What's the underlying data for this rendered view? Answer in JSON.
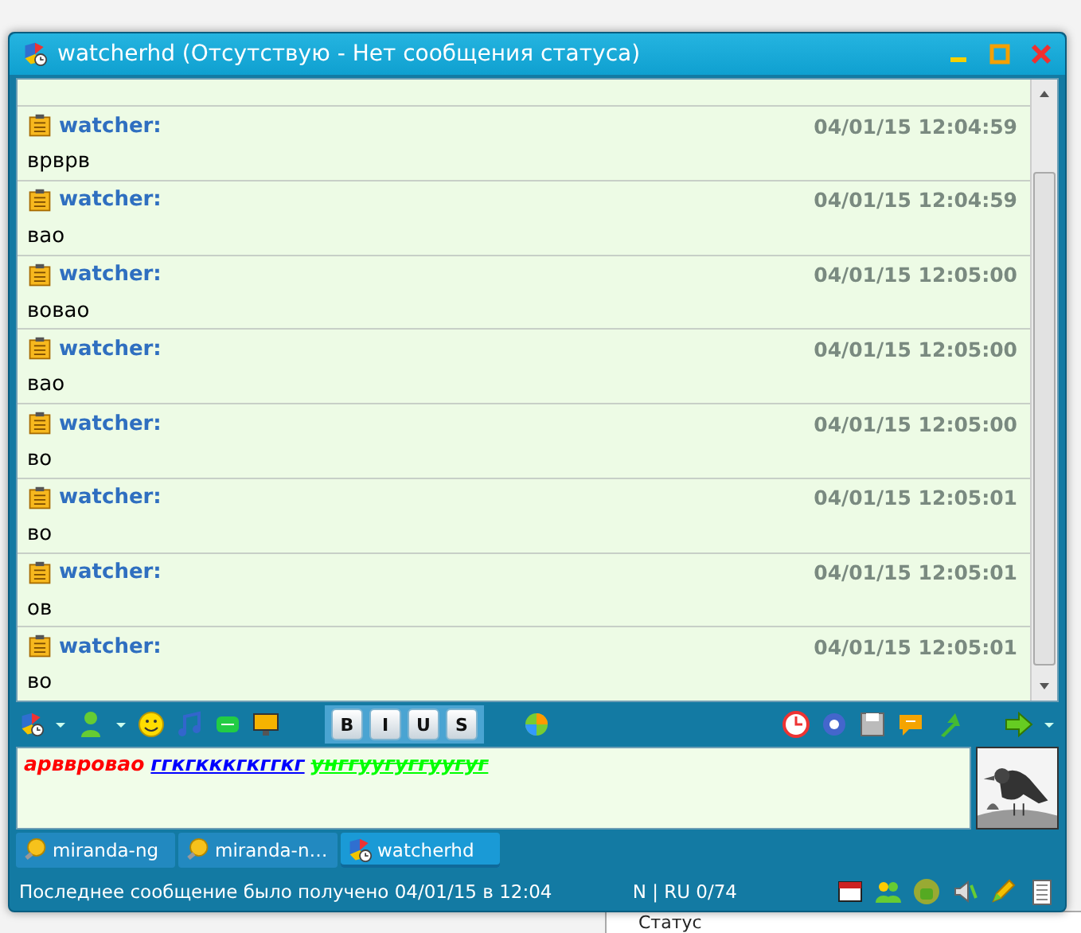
{
  "window": {
    "title": "watcherhd (Отсутствую - Нет сообщения статуса)"
  },
  "messages": [
    {
      "author": "watcher:",
      "time": "04/01/15 12:04:59",
      "text": "врврв"
    },
    {
      "author": "watcher:",
      "time": "04/01/15 12:04:59",
      "text": "вао"
    },
    {
      "author": "watcher:",
      "time": "04/01/15 12:05:00",
      "text": "вовао"
    },
    {
      "author": "watcher:",
      "time": "04/01/15 12:05:00",
      "text": "вао"
    },
    {
      "author": "watcher:",
      "time": "04/01/15 12:05:00",
      "text": "во"
    },
    {
      "author": "watcher:",
      "time": "04/01/15 12:05:01",
      "text": "во"
    },
    {
      "author": "watcher:",
      "time": "04/01/15 12:05:01",
      "text": "ов"
    },
    {
      "author": "watcher:",
      "time": "04/01/15 12:05:01",
      "text": "во"
    }
  ],
  "format_buttons": [
    "B",
    "I",
    "U",
    "S"
  ],
  "input": {
    "segments": [
      {
        "text": "арввровао",
        "color": "#ff0000",
        "underline": false,
        "strike": false
      },
      {
        "text": "ггкгкккгкггкг",
        "color": "#0000ff",
        "underline": true,
        "strike": false
      },
      {
        "text": "унггуугуггуугуг",
        "color": "#00ff00",
        "underline": true,
        "strike": true
      }
    ]
  },
  "tabs": [
    {
      "label": "miranda-ng",
      "kind": "bulb",
      "selected": false
    },
    {
      "label": "miranda-n…",
      "kind": "bulb",
      "selected": false
    },
    {
      "label": "watcherhd",
      "kind": "contact",
      "selected": true
    }
  ],
  "status_bar": {
    "message": "Последнее сообщение было получено 04/01/15 в 12:04",
    "info": "N | RU 0/74"
  },
  "background": {
    "label": "Статус"
  }
}
